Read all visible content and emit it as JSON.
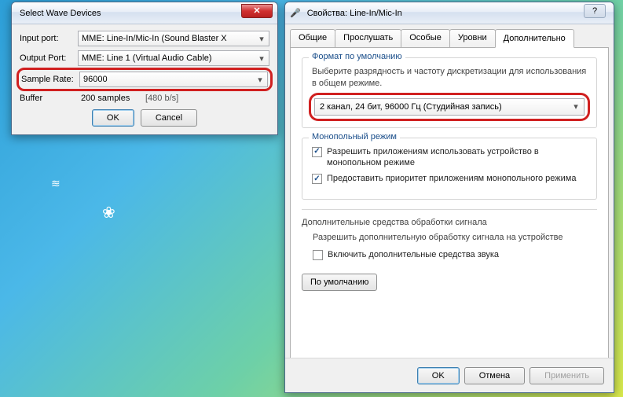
{
  "wallpaper": {
    "leaf": "❀",
    "bird": "≋"
  },
  "win1": {
    "title": "Select Wave Devices",
    "rows": {
      "input_label": "Input port:",
      "input_value": "MME: Line-In/Mic-In (Sound Blaster X",
      "output_label": "Output Port:",
      "output_value": "MME: Line 1 (Virtual Audio Cable)",
      "sample_label": "Sample Rate:",
      "sample_value": "96000",
      "buffer_label": "Buffer",
      "buffer_value": "200 samples",
      "buffer_rate": "[480 b/s]"
    },
    "buttons": {
      "ok": "OK",
      "cancel": "Cancel"
    }
  },
  "win2": {
    "title": "Свойства: Line-In/Mic-In",
    "help": "?",
    "tabs": [
      "Общие",
      "Прослушать",
      "Особые",
      "Уровни",
      "Дополнительно"
    ],
    "active_tab": 4,
    "format_group": {
      "legend": "Формат по умолчанию",
      "desc": "Выберите разрядность и частоту дискретизации для использования в общем режиме.",
      "combo": "2 канал, 24 бит, 96000 Гц (Студийная запись)"
    },
    "exclusive_group": {
      "legend": "Монопольный режим",
      "check1": "Разрешить приложениям использовать устройство в монопольном режиме",
      "check2": "Предоставить приоритет приложениям монопольного режима"
    },
    "extra": {
      "heading": "Дополнительные средства обработки сигнала",
      "desc": "Разрешить дополнительную обработку сигнала на устройстве",
      "check": "Включить дополнительные средства звука"
    },
    "default_btn": "По умолчанию",
    "bottom": {
      "ok": "OK",
      "cancel": "Отмена",
      "apply": "Применить"
    }
  }
}
